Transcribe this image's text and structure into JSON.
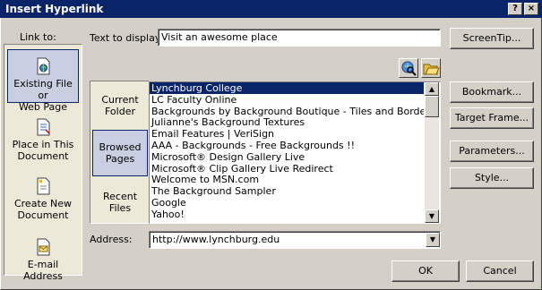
{
  "window": {
    "title": "Insert Hyperlink",
    "help_label": "?",
    "close_label": "×"
  },
  "link_to": {
    "heading": "Link to:",
    "items": [
      {
        "label_line1": "Existing File or",
        "label_line2": "Web Page",
        "icon": "existing-file-web-page-icon",
        "selected": true
      },
      {
        "label_line1": "Place in This",
        "label_line2": "Document",
        "icon": "place-in-document-icon"
      },
      {
        "label_line1": "Create New",
        "label_line2": "Document",
        "icon": "create-new-document-icon"
      },
      {
        "label_line1": "E-mail Address",
        "label_line2": "",
        "icon": "email-address-icon"
      }
    ]
  },
  "text_to_display": {
    "label": "Text to display:",
    "value": "Visit an awesome place"
  },
  "buttons": {
    "screentip": "ScreenTip...",
    "bookmark": "Bookmark...",
    "target_frame": "Target Frame...",
    "parameters": "Parameters...",
    "style": "Style...",
    "ok": "OK",
    "cancel": "Cancel"
  },
  "toolbar_icons": [
    "browse-web-icon",
    "browse-file-icon"
  ],
  "look_in_tabs": [
    {
      "line1": "Current",
      "line2": "Folder"
    },
    {
      "line1": "Browsed",
      "line2": "Pages",
      "selected": true
    },
    {
      "line1": "Recent",
      "line2": "Files"
    }
  ],
  "list": {
    "selected_index": 0,
    "items": [
      "Lynchburg College",
      "LC Faculty Online",
      "Backgrounds by Background Boutique - Tiles and Borders",
      "Julianne's Background Textures",
      "Email Features | VeriSign",
      "AAA - Backgrounds - Free Backgrounds !!",
      "Microsoft® Design Gallery Live",
      "Microsoft® Clip Gallery Live Redirect",
      "Welcome to MSN.com",
      "The Background Sampler",
      "Google",
      "Yahoo!"
    ]
  },
  "address": {
    "label": "Address:",
    "value": "http://www.lynchburg.edu"
  },
  "colors": {
    "titlebar": "#0a246a",
    "face": "#d4d0c8",
    "selection": "#0a246a"
  }
}
